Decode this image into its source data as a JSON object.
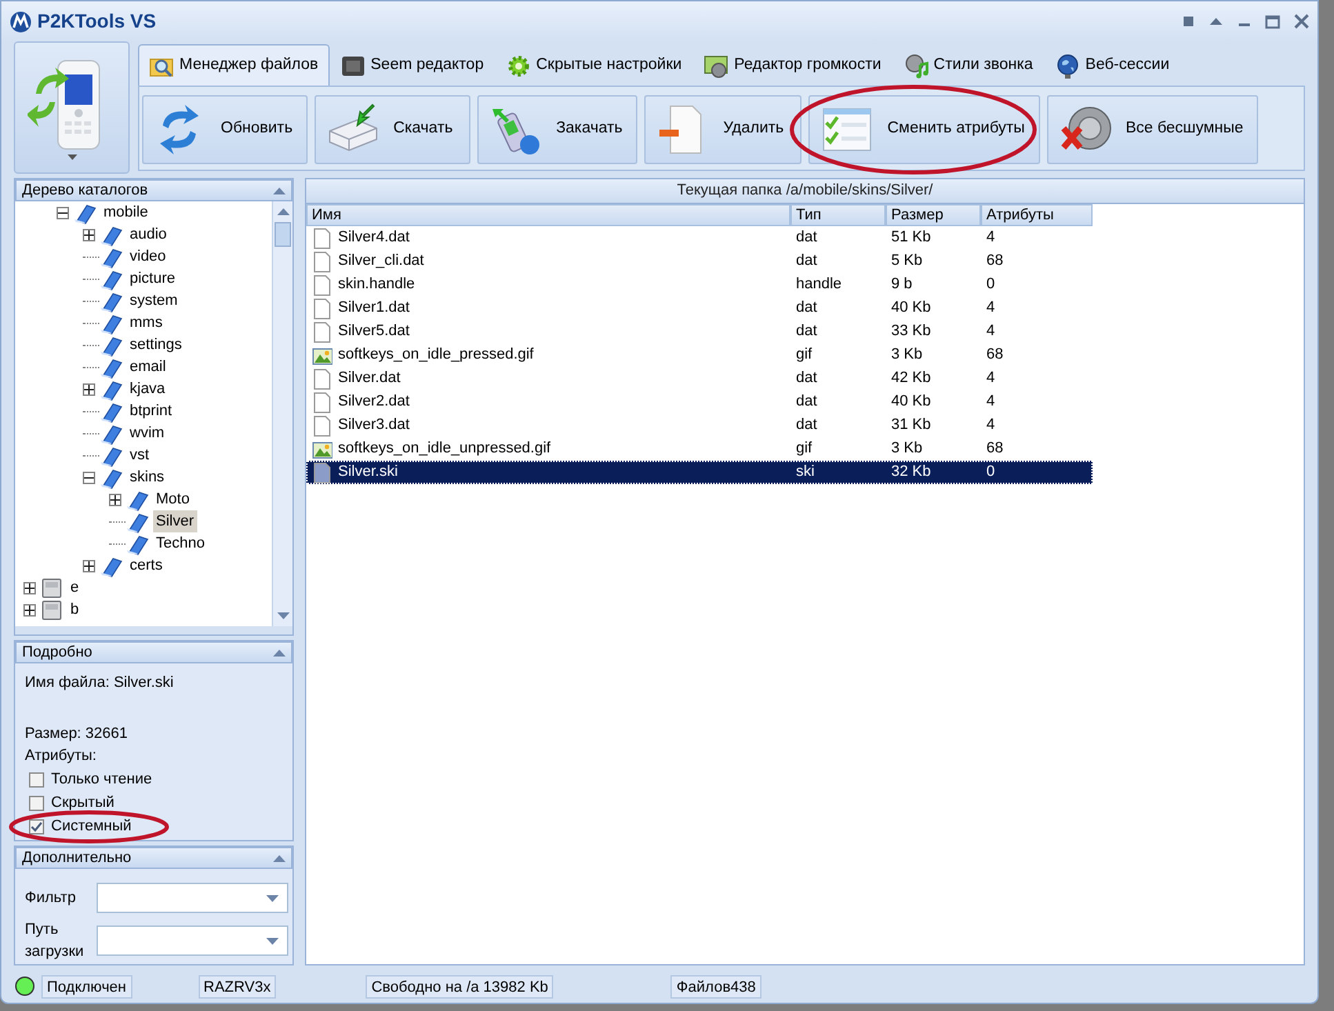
{
  "window": {
    "title": "P2KTools VS"
  },
  "tabs": [
    {
      "label": "Менеджер файлов",
      "selected": true
    },
    {
      "label": "Seem редактор",
      "selected": false
    },
    {
      "label": "Скрытые настройки",
      "selected": false
    },
    {
      "label": "Редактор громкости",
      "selected": false
    },
    {
      "label": "Стили звонка",
      "selected": false
    },
    {
      "label": "Веб-сессии",
      "selected": false
    }
  ],
  "toolbar": [
    {
      "label": "Обновить",
      "circled": false
    },
    {
      "label": "Скачать",
      "circled": false
    },
    {
      "label": "Закачать",
      "circled": false
    },
    {
      "label": "Удалить",
      "circled": false
    },
    {
      "label": "Сменить атрибуты",
      "circled": true
    },
    {
      "label": "Все бесшумные",
      "circled": false
    }
  ],
  "tree": {
    "title": "Дерево каталогов",
    "items": [
      {
        "label": "mobile",
        "kind": "folder",
        "expanded": true,
        "selected": false,
        "children": [
          {
            "label": "audio",
            "kind": "folder",
            "expanded": false,
            "selected": false
          },
          {
            "label": "video",
            "kind": "folder",
            "selected": false
          },
          {
            "label": "picture",
            "kind": "folder",
            "selected": false
          },
          {
            "label": "system",
            "kind": "folder",
            "selected": false
          },
          {
            "label": "mms",
            "kind": "folder",
            "selected": false
          },
          {
            "label": "settings",
            "kind": "folder",
            "selected": false
          },
          {
            "label": "email",
            "kind": "folder",
            "selected": false
          },
          {
            "label": "kjava",
            "kind": "folder",
            "expanded": false,
            "selected": false
          },
          {
            "label": "btprint",
            "kind": "folder",
            "selected": false
          },
          {
            "label": "wvim",
            "kind": "folder",
            "selected": false
          },
          {
            "label": "vst",
            "kind": "folder",
            "selected": false
          },
          {
            "label": "skins",
            "kind": "folder",
            "expanded": true,
            "selected": false,
            "children": [
              {
                "label": "Moto",
                "kind": "folder",
                "expanded": false,
                "selected": false
              },
              {
                "label": "Silver",
                "kind": "folder",
                "selected": true
              },
              {
                "label": "Techno",
                "kind": "folder",
                "selected": false
              }
            ]
          },
          {
            "label": "certs",
            "kind": "folder",
            "expanded": false,
            "selected": false
          }
        ]
      },
      {
        "label": "e",
        "kind": "drive",
        "expanded": false,
        "selected": false
      },
      {
        "label": "b",
        "kind": "drive",
        "expanded": false,
        "selected": false
      }
    ]
  },
  "details": {
    "title": "Подробно",
    "file_name": "Имя файла: Silver.ski",
    "size": "Размер: 32661",
    "attributes_label": "Атрибуты:",
    "attributes": [
      {
        "label": "Только чтение",
        "checked": false,
        "circled": false
      },
      {
        "label": "Скрытый",
        "checked": false,
        "circled": false
      },
      {
        "label": "Системный",
        "checked": true,
        "circled": true
      }
    ]
  },
  "extra": {
    "title": "Дополнительно",
    "fields": [
      {
        "label": "Фильтр"
      },
      {
        "label": "Путь загрузки"
      }
    ]
  },
  "folder_caption": "Текущая папка /a/mobile/skins/Silver/",
  "table": {
    "columns": [
      "Имя",
      "Тип",
      "Размер",
      "Атрибуты"
    ],
    "rows": [
      {
        "kind": "file",
        "cells": [
          "Silver4.dat",
          "dat",
          "51 Kb",
          "4"
        ],
        "selected": false
      },
      {
        "kind": "file",
        "cells": [
          "Silver_cli.dat",
          "dat",
          "5 Kb",
          "68"
        ],
        "selected": false
      },
      {
        "kind": "file",
        "cells": [
          "skin.handle",
          "handle",
          "9 b",
          "0"
        ],
        "selected": false
      },
      {
        "kind": "file",
        "cells": [
          "Silver1.dat",
          "dat",
          "40 Kb",
          "4"
        ],
        "selected": false
      },
      {
        "kind": "file",
        "cells": [
          "Silver5.dat",
          "dat",
          "33 Kb",
          "4"
        ],
        "selected": false
      },
      {
        "kind": "image",
        "cells": [
          "softkeys_on_idle_pressed.gif",
          "gif",
          "3 Kb",
          "68"
        ],
        "selected": false
      },
      {
        "kind": "file",
        "cells": [
          "Silver.dat",
          "dat",
          "42 Kb",
          "4"
        ],
        "selected": false
      },
      {
        "kind": "file",
        "cells": [
          "Silver2.dat",
          "dat",
          "40 Kb",
          "4"
        ],
        "selected": false
      },
      {
        "kind": "file",
        "cells": [
          "Silver3.dat",
          "dat",
          "31 Kb",
          "4"
        ],
        "selected": false
      },
      {
        "kind": "image",
        "cells": [
          "softkeys_on_idle_unpressed.gif",
          "gif",
          "3 Kb",
          "68"
        ],
        "selected": false
      },
      {
        "kind": "file",
        "cells": [
          "Silver.ski",
          "ski",
          "32 Kb",
          "0"
        ],
        "selected": true
      }
    ]
  },
  "status_bar": {
    "connected": true,
    "items": [
      "Подключен",
      "RAZRV3x",
      "Свободно на /a 13982 Kb",
      "Файлов438"
    ]
  }
}
